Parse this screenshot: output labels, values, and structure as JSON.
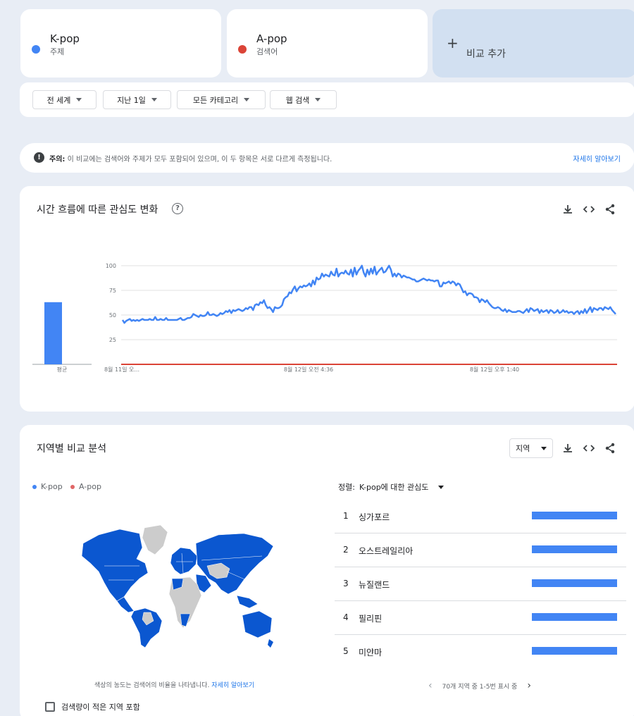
{
  "terms": [
    {
      "name": "K-pop",
      "type": "주제",
      "color": "#4285f4"
    },
    {
      "name": "A-pop",
      "type": "검색어",
      "color": "#db4437"
    }
  ],
  "add_compare": {
    "label": "비교 추가"
  },
  "filters": [
    {
      "label": "전 세계"
    },
    {
      "label": "지난 1일"
    },
    {
      "label": "모든 카테고리"
    },
    {
      "label": "웹 검색"
    }
  ],
  "notice": {
    "title": "주의:",
    "text": "이 비교에는 검색어와 주제가 모두 포함되어 있으며, 이 두 항목은 서로 다르게 측정됩니다.",
    "link": "자세히 알아보기"
  },
  "interest_over_time": {
    "title": "시간 흐름에 따른 관심도 변화",
    "avg_label": "평균",
    "icons": [
      "download-icon",
      "embed-icon",
      "share-icon"
    ]
  },
  "chart_data": {
    "type": "line",
    "y_ticks": [
      "100",
      "75",
      "50",
      "25"
    ],
    "ylim": [
      0,
      100
    ],
    "x_tick_labels": [
      "8월 11일 오...",
      "8월 12일 오전 4:36",
      "8월 12일 오후 1:40"
    ],
    "averages": [
      {
        "name": "K-pop",
        "value": 63
      },
      {
        "name": "A-pop",
        "value": 0
      }
    ],
    "series": [
      {
        "name": "K-pop",
        "color": "#4285f4",
        "values": [
          45,
          42,
          44,
          45,
          46,
          44,
          45,
          44,
          45,
          44,
          45,
          46,
          45,
          45,
          45,
          46,
          45,
          45,
          48,
          45,
          45,
          46,
          45,
          45,
          47,
          45,
          45,
          45,
          45,
          45,
          45,
          46,
          47,
          45,
          45,
          46,
          47,
          47,
          48,
          51,
          50,
          49,
          48,
          50,
          49,
          49,
          50,
          53,
          50,
          50,
          51,
          50,
          49,
          50,
          52,
          51,
          52,
          54,
          53,
          55,
          52,
          55,
          54,
          55,
          56,
          55,
          54,
          55,
          57,
          56,
          58,
          58,
          55,
          60,
          61,
          60,
          63,
          62,
          65,
          60,
          57,
          58,
          56,
          53,
          58,
          57,
          57,
          58,
          60,
          66,
          68,
          69,
          73,
          72,
          76,
          79,
          74,
          77,
          79,
          78,
          80,
          79,
          80,
          82,
          79,
          85,
          81,
          88,
          86,
          87,
          92,
          89,
          91,
          90,
          89,
          94,
          91,
          90,
          97,
          89,
          92,
          93,
          92,
          95,
          92,
          91,
          96,
          89,
          98,
          91,
          95,
          97,
          100,
          93,
          89,
          96,
          91,
          97,
          92,
          99,
          91,
          94,
          96,
          98,
          93,
          94,
          97,
          100,
          96,
          89,
          92,
          89,
          92,
          91,
          88,
          90,
          89,
          88,
          88,
          87,
          86,
          86,
          84,
          84,
          85,
          86,
          87,
          86,
          85,
          86,
          85,
          85,
          84,
          85,
          85,
          79,
          79,
          83,
          82,
          83,
          84,
          82,
          84,
          83,
          80,
          82,
          81,
          77,
          73,
          74,
          70,
          72,
          72,
          71,
          68,
          68,
          67,
          63,
          66,
          65,
          63,
          65,
          62,
          60,
          58,
          57,
          57,
          58,
          57,
          55,
          54,
          56,
          53,
          55,
          54,
          53,
          53,
          53,
          54,
          54,
          53,
          52,
          54,
          56,
          53,
          57,
          56,
          54,
          55,
          56,
          52,
          55,
          53,
          54,
          55,
          52,
          55,
          54,
          52,
          53,
          55,
          52,
          53,
          55,
          53,
          54,
          52,
          53,
          53,
          51,
          53,
          54,
          51,
          54,
          52,
          56,
          52,
          55,
          58,
          53,
          57,
          56,
          55,
          57,
          57,
          55,
          58,
          57,
          56,
          58,
          55,
          53,
          51
        ]
      },
      {
        "name": "A-pop",
        "color": "#db4437",
        "values": [
          0,
          0
        ]
      }
    ]
  },
  "regional": {
    "title": "지역별 비교 분석",
    "region_select": "지역",
    "legend": [
      {
        "name": "K-pop",
        "color": "#4285f4"
      },
      {
        "name": "A-pop",
        "color": "#e06666"
      }
    ],
    "sort_label": "정렬:",
    "sort_value": "K-pop에 대한 관심도",
    "rows": [
      {
        "rank": "1",
        "name": "싱가포르",
        "share": 1.0
      },
      {
        "rank": "2",
        "name": "오스트레일리아",
        "share": 1.0
      },
      {
        "rank": "3",
        "name": "뉴질랜드",
        "share": 1.0
      },
      {
        "rank": "4",
        "name": "필리핀",
        "share": 1.0
      },
      {
        "rank": "5",
        "name": "미얀마",
        "share": 1.0
      }
    ],
    "map_note": "색상의 농도는 검색어의 비율을 나타냅니다.",
    "map_note_link": "자세히 알아보기",
    "pager_text": "70개 지역 중 1-5번 표시 중",
    "checkbox_label": "검색량이 적은 지역 포함",
    "map_colors": {
      "interest": "#0b57d0",
      "no_data": "#cccccc"
    }
  }
}
